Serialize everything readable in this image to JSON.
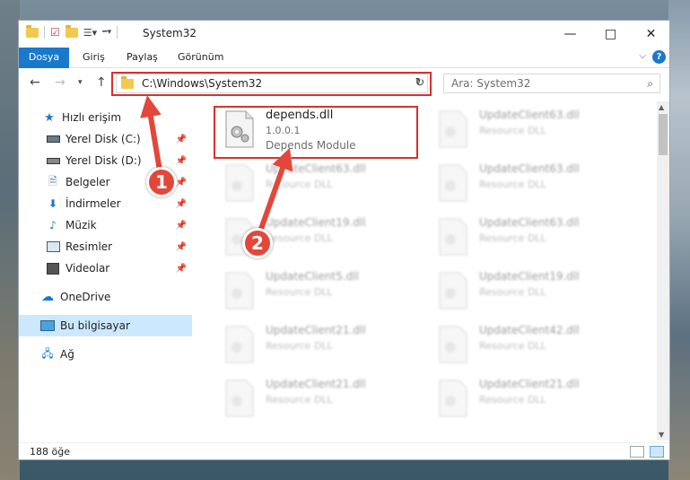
{
  "window": {
    "title": "System32"
  },
  "ribbon": {
    "tabs": [
      "Dosya",
      "Giriş",
      "Paylaş",
      "Görünüm"
    ],
    "help": "?"
  },
  "nav": {
    "address": "C:\\Windows\\System32",
    "search_placeholder": "Ara: System32"
  },
  "sidebar": {
    "quick_access": "Hızlı erişim",
    "items": [
      "Yerel Disk (C:)",
      "Yerel Disk (D:)",
      "Belgeler",
      "İndirmeler",
      "Müzik",
      "Resimler",
      "Videolar"
    ],
    "onedrive": "OneDrive",
    "this_pc": "Bu bilgisayar",
    "network": "Ağ"
  },
  "files": {
    "highlight": {
      "name": "depends.dll",
      "version": "1.0.0.1",
      "desc": "Depends Module"
    },
    "left_col": [
      {
        "name": "UpdateClient63.dll",
        "desc": "Resource DLL"
      },
      {
        "name": "UpdateClient19.dll",
        "desc": "Resource DLL"
      },
      {
        "name": "UpdateClient5.dll",
        "desc": "Resource DLL"
      },
      {
        "name": "UpdateClient21.dll",
        "desc": "Resource DLL"
      },
      {
        "name": "UpdateClient21.dll",
        "desc": "Resource DLL"
      }
    ],
    "right_col": [
      {
        "name": "UpdateClient63.dll",
        "desc": "Resource DLL"
      },
      {
        "name": "UpdateClient63.dll",
        "desc": "Resource DLL"
      },
      {
        "name": "UpdateClient63.dll",
        "desc": "Resource DLL"
      },
      {
        "name": "UpdateClient19.dll",
        "desc": "Resource DLL"
      },
      {
        "name": "UpdateClient42.dll",
        "desc": "Resource DLL"
      },
      {
        "name": "UpdateClient21.dll",
        "desc": "Resource DLL"
      }
    ]
  },
  "status": {
    "count": "188 öğe"
  },
  "annotations": {
    "badge1": "1",
    "badge2": "2",
    "arrow_color": "#e2473a",
    "box_color": "#d9302c"
  }
}
